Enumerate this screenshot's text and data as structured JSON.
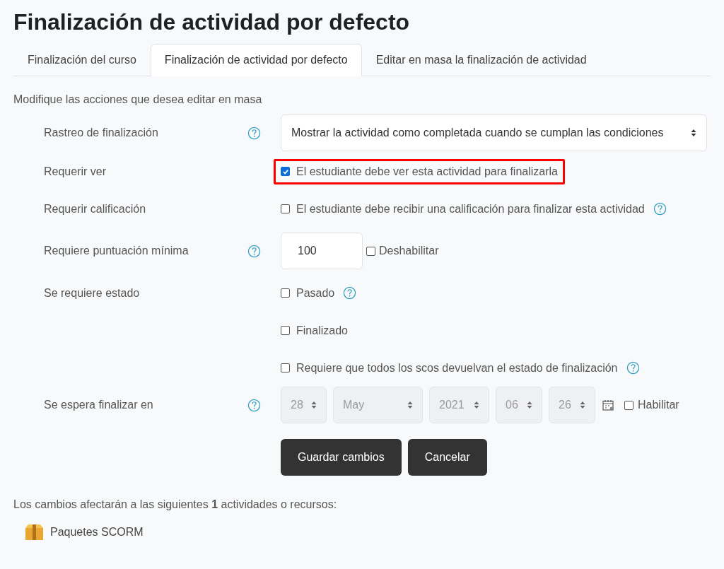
{
  "title": "Finalización de actividad por defecto",
  "tabs": [
    {
      "label": "Finalización del curso",
      "selected": false
    },
    {
      "label": "Finalización de actividad por defecto",
      "selected": true
    },
    {
      "label": "Editar en masa la finalización de actividad",
      "selected": false
    }
  ],
  "intro": "Modifique las acciones que desea editar en masa",
  "rows": [
    {
      "kind": "select",
      "label": "Rastreo de finalización",
      "help": true,
      "value": "Mostrar la actividad como completada cuando se cumplan las condiciones"
    },
    {
      "kind": "checkboxes",
      "label": "Requerir ver",
      "help": false,
      "options": [
        {
          "text": "El estudiante debe ver esta actividad para finalizarla",
          "checked": true,
          "help": false,
          "highlighted": true
        }
      ]
    },
    {
      "kind": "checkboxes",
      "label": "Requerir calificación",
      "help": false,
      "options": [
        {
          "text": "El estudiante debe recibir una calificación para finalizar esta actividad",
          "checked": false,
          "help": true,
          "highlighted": false
        }
      ]
    },
    {
      "kind": "number",
      "label": "Requiere puntuación mínima",
      "help": true,
      "value": "100",
      "toggle": {
        "text": "Deshabilitar",
        "checked": false
      }
    },
    {
      "kind": "checkboxes",
      "label": "Se requiere estado",
      "help": false,
      "options": [
        {
          "text": "Pasado",
          "checked": false,
          "help": true,
          "highlighted": false
        },
        {
          "text": "Finalizado",
          "checked": false,
          "help": false,
          "highlighted": false
        },
        {
          "text": "Requiere que todos los scos devuelvan el estado de finalización",
          "checked": false,
          "help": true,
          "highlighted": false
        }
      ]
    },
    {
      "kind": "date",
      "label": "Se espera finalizar en",
      "help": true,
      "disabled": true,
      "parts": [
        "28",
        "May",
        "2021",
        "06",
        "26"
      ],
      "toggle": {
        "text": "Habilitar",
        "checked": false
      }
    }
  ],
  "buttons": [
    "Guardar cambios",
    "Cancelar"
  ],
  "footer": "Los cambios afectarán a las siguientes **1** actividades o recursos:",
  "items": [
    "Paquetes SCORM"
  ]
}
